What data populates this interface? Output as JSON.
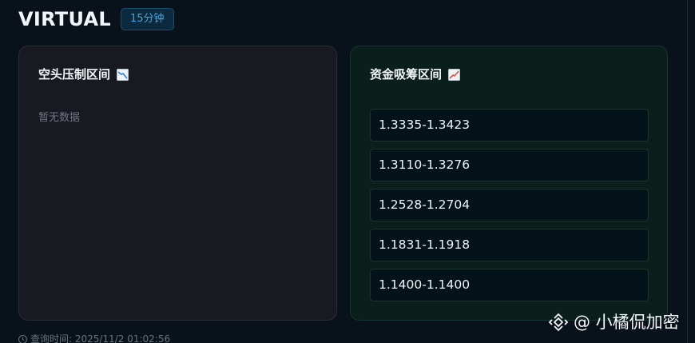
{
  "header": {
    "symbol": "VIRTUAL",
    "timeframe": "15分钟"
  },
  "short_panel": {
    "title": "空头压制区间",
    "icon": "chart-decreasing-icon",
    "empty_text": "暂无数据"
  },
  "accum_panel": {
    "title": "资金吸筹区间",
    "icon": "chart-increasing-icon",
    "ranges": [
      "1.3335-1.3423",
      "1.3110-1.3276",
      "1.2528-1.2704",
      "1.1831-1.1918",
      "1.1400-1.1400"
    ]
  },
  "footer": {
    "query_time": "查询时间: 2025/11/2 01:02:56"
  },
  "watermark": {
    "text": "@ 小橘侃加密"
  },
  "colors": {
    "background": "#09111a",
    "badge_text": "#3fa7e4",
    "accum_panel_bg": "#0a1e1c",
    "short_panel_bg": "#181921"
  }
}
